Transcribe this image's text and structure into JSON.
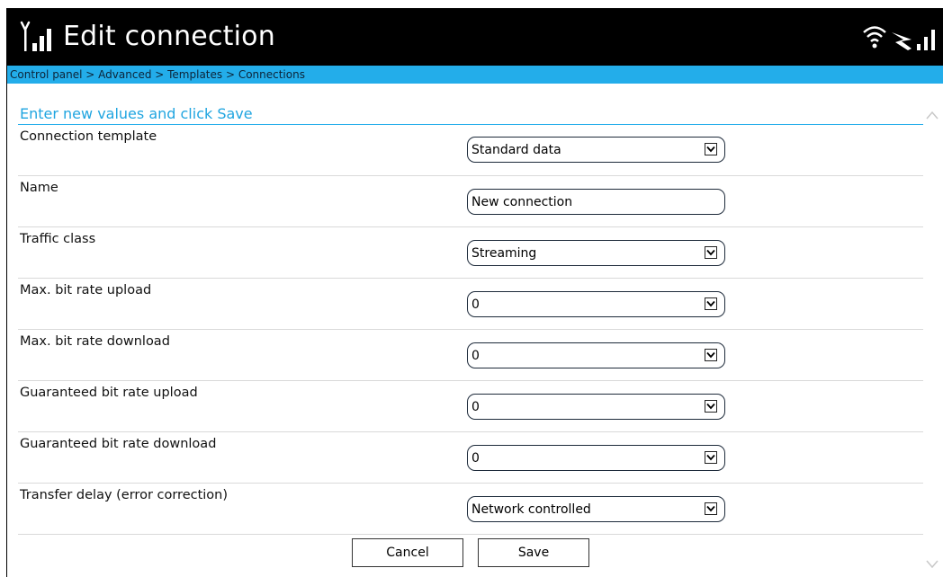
{
  "header": {
    "title": "Edit connection",
    "logo_icon": "signal-antenna-icon",
    "status_icons": [
      "wifi-icon",
      "satellite-link-icon",
      "signal-strength-icon"
    ]
  },
  "breadcrumb": "Control panel > Advanced > Templates > Connections",
  "form": {
    "section_title": "Enter new values and click Save",
    "rows": [
      {
        "label": "Connection template",
        "value": "Standard data",
        "type": "select"
      },
      {
        "label": "Name",
        "value": "New connection",
        "type": "text"
      },
      {
        "label": "Traffic class",
        "value": "Streaming",
        "type": "select"
      },
      {
        "label": "Max. bit rate upload",
        "value": "0",
        "type": "select"
      },
      {
        "label": "Max. bit rate download",
        "value": "0",
        "type": "select"
      },
      {
        "label": "Guaranteed bit rate upload",
        "value": "0",
        "type": "select"
      },
      {
        "label": "Guaranteed bit rate download",
        "value": "0",
        "type": "select"
      },
      {
        "label": "Transfer delay (error correction)",
        "value": "Network controlled",
        "type": "select"
      }
    ]
  },
  "buttons": {
    "cancel_label": "Cancel",
    "save_label": "Save"
  },
  "colors": {
    "titlebar": "#000000",
    "accent": "#23adea",
    "section_title": "#20a5e0"
  }
}
